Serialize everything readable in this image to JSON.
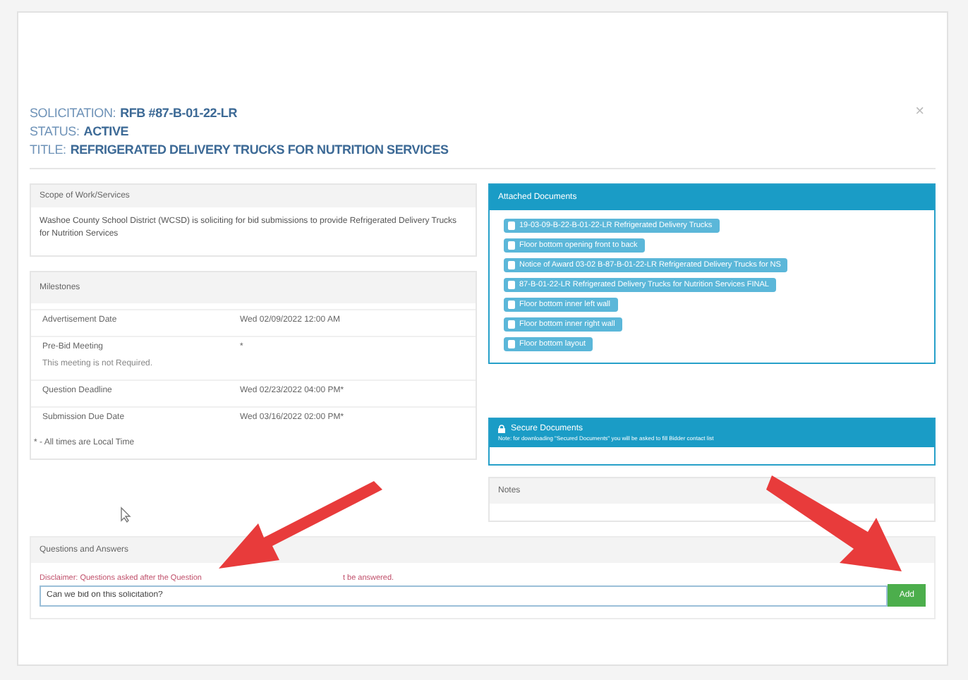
{
  "header": {
    "fields": [
      {
        "label": "SOLICITATION:",
        "value": "RFB #87-B-01-22-LR"
      },
      {
        "label": "STATUS:",
        "value": "ACTIVE"
      },
      {
        "label": "TITLE:",
        "value": "REFRIGERATED DELIVERY TRUCKS FOR NUTRITION SERVICES"
      }
    ],
    "close": "×"
  },
  "scope": {
    "title": "Scope of Work/Services",
    "text": "Washoe County School District (WCSD) is soliciting for bid submissions to provide Refrigerated Delivery Trucks for Nutrition Services"
  },
  "milestones": {
    "title": "Milestones",
    "rows": [
      {
        "label": "Advertisement Date",
        "value": "Wed 02/09/2022 12:00 AM"
      },
      {
        "label": "Pre-Bid Meeting",
        "value": "*",
        "note": "This meeting is not Required."
      },
      {
        "label": "Question Deadline",
        "value": "Wed 02/23/2022 04:00 PM*"
      },
      {
        "label": "Submission Due Date",
        "value": "Wed 03/16/2022 02:00 PM*"
      }
    ],
    "footnote": "* - All times are Local Time"
  },
  "attached_documents": {
    "title": "Attached Documents",
    "items": [
      "19-03-09-B-22-B-01-22-LR Refrigerated Delivery Trucks",
      "Floor bottom opening front to back",
      "Notice of Award 03-02 B-87-B-01-22-LR Refrigerated Delivery Trucks for NS",
      "87-B-01-22-LR Refrigerated Delivery Trucks for Nutrition Services FINAL",
      "Floor bottom inner left wall",
      "Floor bottom inner right wall",
      "Floor bottom layout"
    ]
  },
  "secure_documents": {
    "title": "Secure Documents",
    "note": "Note: for downloading \"Secured Documents\" you will be asked to fill Bidder contact list"
  },
  "notes": {
    "title": "Notes"
  },
  "questions": {
    "title": "Questions and Answers",
    "disclaimer_parts": [
      "Disclaimer: Questions asked after the Question",
      "t be answered."
    ],
    "value": "Can we bid on this solicitation?",
    "button": "Add"
  }
}
